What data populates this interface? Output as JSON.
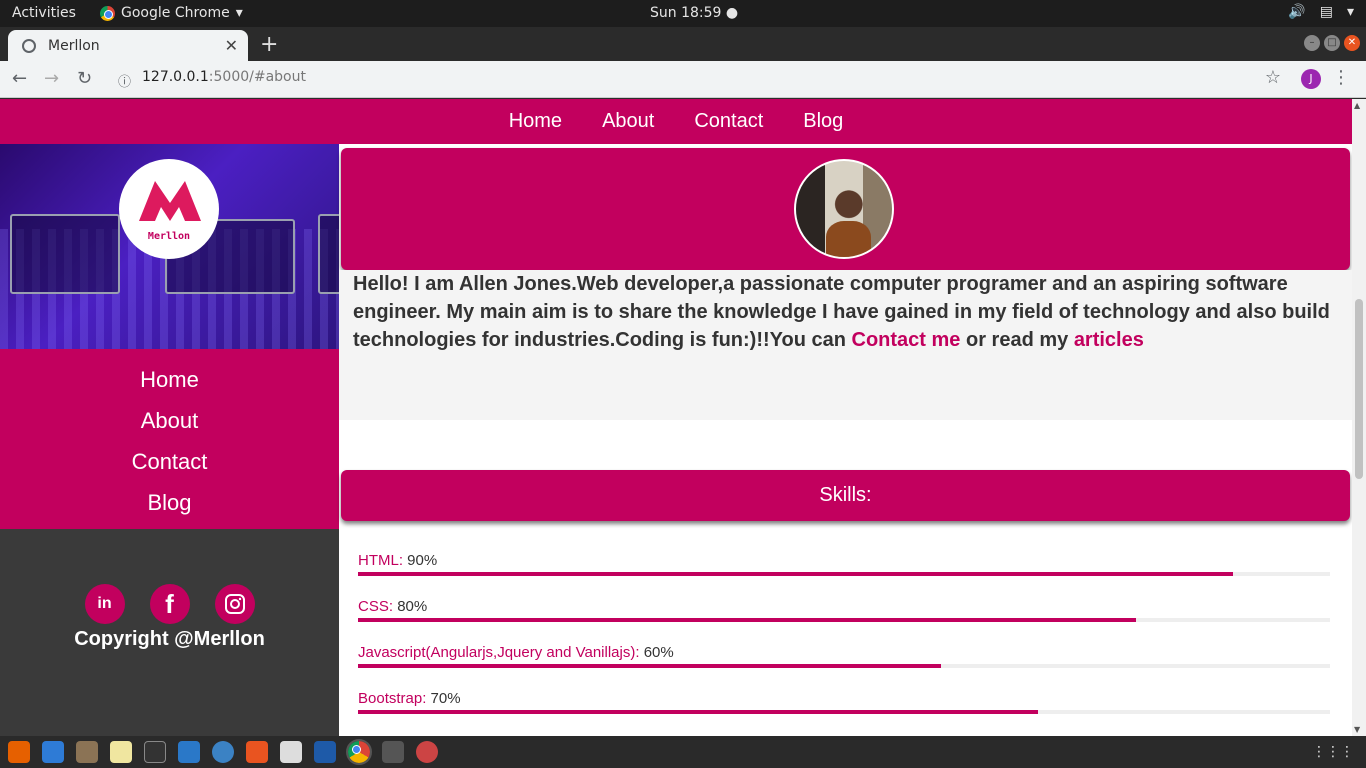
{
  "system_bar": {
    "activities": "Activities",
    "app_name": "Google Chrome",
    "clock": "Sun 18:59"
  },
  "browser": {
    "tab_title": "Merllon",
    "url_host": "127.0.0.1",
    "url_rest": ":5000/#about",
    "profile_initial": "J"
  },
  "top_nav": {
    "items": [
      "Home",
      "About",
      "Contact",
      "Blog"
    ]
  },
  "sidebar": {
    "logo_text": "Merllon",
    "menu": [
      "Home",
      "About",
      "Contact",
      "Blog"
    ],
    "copyright": "Copyright @Merllon",
    "socials": [
      "linkedin-icon",
      "facebook-icon",
      "instagram-icon"
    ]
  },
  "about": {
    "bio_text": "Hello! I am Allen Jones.Web developer,a passionate computer programer and an aspiring software engineer. My main aim is to share the knowledge I have gained in my field of technology and also build technologies for industries.Coding is fun:)!!You can ",
    "contact_link": "Contact me",
    "middle_text": " or read my ",
    "articles_link": "articles"
  },
  "skills": {
    "heading": "Skills:",
    "items": [
      {
        "name": "HTML:",
        "percent_label": "90%",
        "level": 0.9
      },
      {
        "name": "CSS:",
        "percent_label": "80%",
        "level": 0.8
      },
      {
        "name": "Javascript(Angularjs,Jquery and Vanillajs):",
        "percent_label": "60%",
        "level": 0.6
      },
      {
        "name": "Bootstrap:",
        "percent_label": "70%",
        "level": 0.7
      }
    ]
  },
  "theme": {
    "accent": "#c2005e",
    "dark": "#3a3a3a"
  }
}
